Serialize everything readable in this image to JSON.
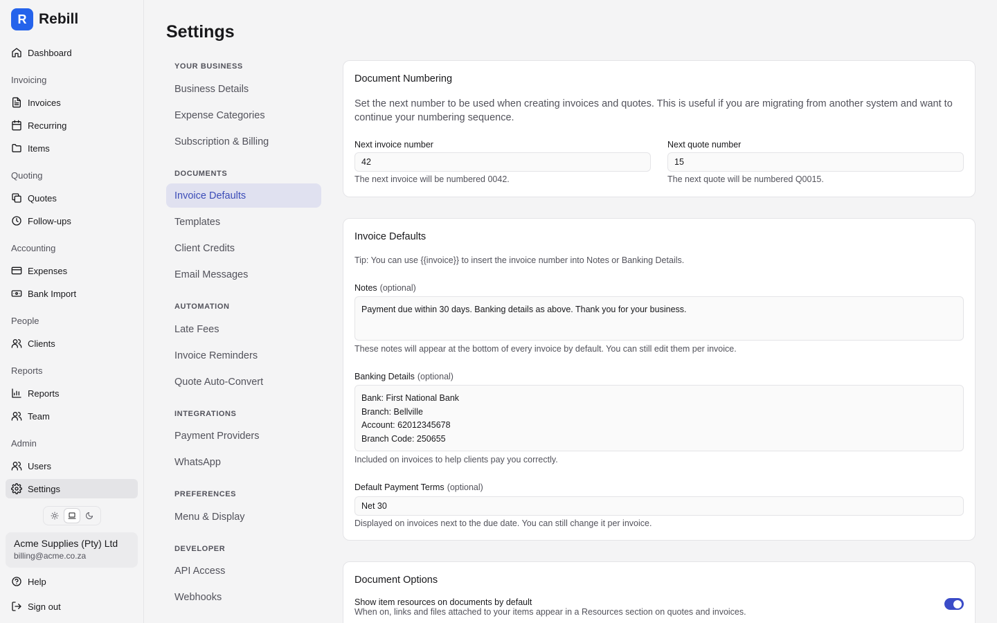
{
  "brand": {
    "logo_letter": "R",
    "name": "Rebill"
  },
  "sidebar": {
    "dashboard": "Dashboard",
    "sections": {
      "invoicing": "Invoicing",
      "quoting": "Quoting",
      "accounting": "Accounting",
      "people": "People",
      "reports": "Reports",
      "admin": "Admin"
    },
    "items": {
      "invoices": "Invoices",
      "recurring": "Recurring",
      "items": "Items",
      "quotes": "Quotes",
      "followups": "Follow-ups",
      "expenses": "Expenses",
      "bank_import": "Bank Import",
      "clients": "Clients",
      "reports": "Reports",
      "team": "Team",
      "users": "Users",
      "settings": "Settings"
    },
    "account": {
      "name": "Acme Supplies (Pty) Ltd",
      "email": "billing@acme.co.za"
    },
    "help": "Help",
    "signout": "Sign out",
    "theme_options": [
      "sun-icon",
      "laptop-icon",
      "moon-icon"
    ],
    "active_theme": "laptop-icon"
  },
  "page": {
    "title": "Settings"
  },
  "subnav": {
    "your_business": "YOUR BUSINESS",
    "business_details": "Business Details",
    "expense_categories": "Expense Categories",
    "subscription_billing": "Subscription & Billing",
    "documents": "DOCUMENTS",
    "invoice_defaults": "Invoice Defaults",
    "templates": "Templates",
    "client_credits": "Client Credits",
    "email_messages": "Email Messages",
    "automation": "AUTOMATION",
    "late_fees": "Late Fees",
    "invoice_reminders": "Invoice Reminders",
    "quote_auto_convert": "Quote Auto-Convert",
    "integrations": "INTEGRATIONS",
    "payment_providers": "Payment Providers",
    "whatsapp": "WhatsApp",
    "preferences": "PREFERENCES",
    "menu_display": "Menu & Display",
    "developer": "DEVELOPER",
    "api_access": "API Access",
    "webhooks": "Webhooks"
  },
  "numbering": {
    "title": "Document Numbering",
    "description": "Set the next number to be used when creating invoices and quotes. This is useful if you are migrating from another system and want to continue your numbering sequence.",
    "invoice_label": "Next invoice number",
    "invoice_value": "42",
    "invoice_help": "The next invoice will be numbered 0042.",
    "quote_label": "Next quote number",
    "quote_value": "15",
    "quote_help": "The next quote will be numbered Q0015."
  },
  "invoice_defaults": {
    "title": "Invoice Defaults",
    "tip": "Tip: You can use {{invoice}} to insert the invoice number into Notes or Banking Details.",
    "notes_label": "Notes",
    "optional": "(optional)",
    "notes_value": "Payment due within 30 days. Banking details as above. Thank you for your business.",
    "notes_help": "These notes will appear at the bottom of every invoice by default. You can still edit them per invoice.",
    "banking_label": "Banking Details",
    "banking_value": "Bank: First National Bank\nBranch: Bellville\nAccount: 62012345678\nBranch Code: 250655",
    "banking_help": "Included on invoices to help clients pay you correctly.",
    "terms_label": "Default Payment Terms",
    "terms_value": "Net 30",
    "terms_help": "Displayed on invoices next to the due date. You can still change it per invoice."
  },
  "document_options": {
    "title": "Document Options",
    "resources_label": "Show item resources on documents by default",
    "resources_help": "When on, links and files attached to your items appear in a Resources section on quotes and invoices.",
    "resources_enabled": true
  },
  "colors": {
    "brand": "#2563eb",
    "accent": "#3b4cc8",
    "active_subnav_bg": "#e0e1f0"
  }
}
